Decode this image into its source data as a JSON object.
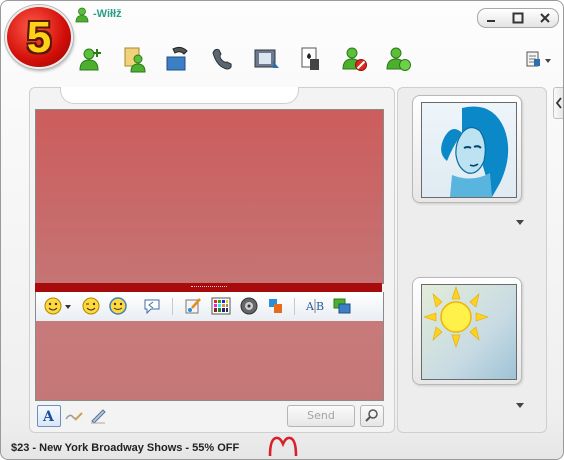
{
  "app": {
    "logo_text": "5",
    "user_name": "-Wiłłž"
  },
  "window_controls": [
    "restore",
    "maximize",
    "close"
  ],
  "toolbar": {
    "icons": [
      "add-contact",
      "contacts",
      "video-call",
      "voice-call",
      "video-clip",
      "cards-game",
      "block-contact",
      "invite-contact",
      "menu-options"
    ]
  },
  "emoji_bar": {
    "icons": [
      "emoticon-picker",
      "wink-emoticon",
      "animated-emoticon",
      "nudge-bubble",
      "paint-tool",
      "color-grid",
      "sound-clip",
      "winks-game",
      "translate",
      "send-image"
    ]
  },
  "compose": {
    "send_label": "Send"
  },
  "colors": {
    "chat_bg": "#cc5d5c",
    "splitter": "#a80b0b",
    "accent_green": "#2a9f86"
  },
  "ad": {
    "text": "$23 - New York Broadway Shows - 55% OFF"
  }
}
